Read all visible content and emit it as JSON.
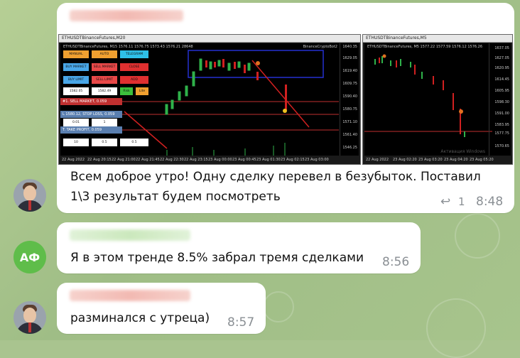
{
  "colors": {
    "bubble": "#ffffff",
    "time": "#8a8f94",
    "avatar_initials_bg": "#5fbd4a"
  },
  "messages": [
    {
      "text_line1": "Всем доброе утро! Одну сделку перевел в безубыток. Поставил",
      "text_line2": "1\\3 результат будем посмотреть",
      "reply_count": "1",
      "time": "8:48",
      "screenshot": {
        "left": {
          "window_title": "ETHUSDTBinanceFutures,M20",
          "chart_header": "ETHUSDTBinanceFutures, M15  1576.11  1576.75  1573.43  1576.21  28648",
          "chart_brand": "BinanceCryptoBot2",
          "panel_buttons": [
            "MANUAL",
            "AUTO",
            "TELEGRAM",
            "BUY MARKET",
            "SELL MARKET",
            "CLOSE",
            "BUY LIMIT",
            "SELL LIMIT",
            "ADD",
            "1582.05",
            "1582.49",
            "Risk",
            "Lite"
          ],
          "order_lines": [
            "#1. SELL MARKET, 0.059",
            "L 1580.12, STOP LOSS, 0.059",
            "T. TAKE PROFIT, 0.059"
          ],
          "field_values": [
            "0.01",
            "1",
            "10",
            "0.5",
            "0.5"
          ],
          "price_axis": [
            "1640.35",
            "1629.05",
            "1619.40",
            "1609.75",
            "1590.40",
            "1580.75",
            "1571.10",
            "1561.40",
            "1546.25"
          ],
          "time_axis": [
            "22 Aug 2022",
            "22 Aug 20:15",
            "22 Aug 21:00",
            "22 Aug 21:45",
            "22 Aug 22:30",
            "22 Aug 23:15",
            "23 Aug 00:00",
            "23 Aug 00:45",
            "23 Aug 01:30",
            "23 Aug 02:15",
            "23 Aug 03:00"
          ]
        },
        "right": {
          "window_title": "ETHUSDTBinanceFutures,M5",
          "chart_header": "ETHUSDTBinanceFutures, M5  1577.22  1577.59  1576.12  1576.26",
          "price_axis": [
            "1637.05",
            "1627.05",
            "1620.95",
            "1614.45",
            "1605.95",
            "1598.30",
            "1591.00",
            "1583.95",
            "1577.75",
            "1570.65"
          ],
          "time_axis": [
            "22 Aug 2022",
            "23 Aug 02:20",
            "23 Aug 03:20",
            "23 Aug 04:20",
            "23 Aug 05:20"
          ],
          "watermark": "Активация Windows"
        }
      }
    },
    {
      "avatar_initials": "АФ",
      "text": "Я в этом тренде 8.5% забрал тремя сделками",
      "time": "8:56"
    },
    {
      "text": "разминался с утреца)",
      "time": "8:57"
    }
  ]
}
